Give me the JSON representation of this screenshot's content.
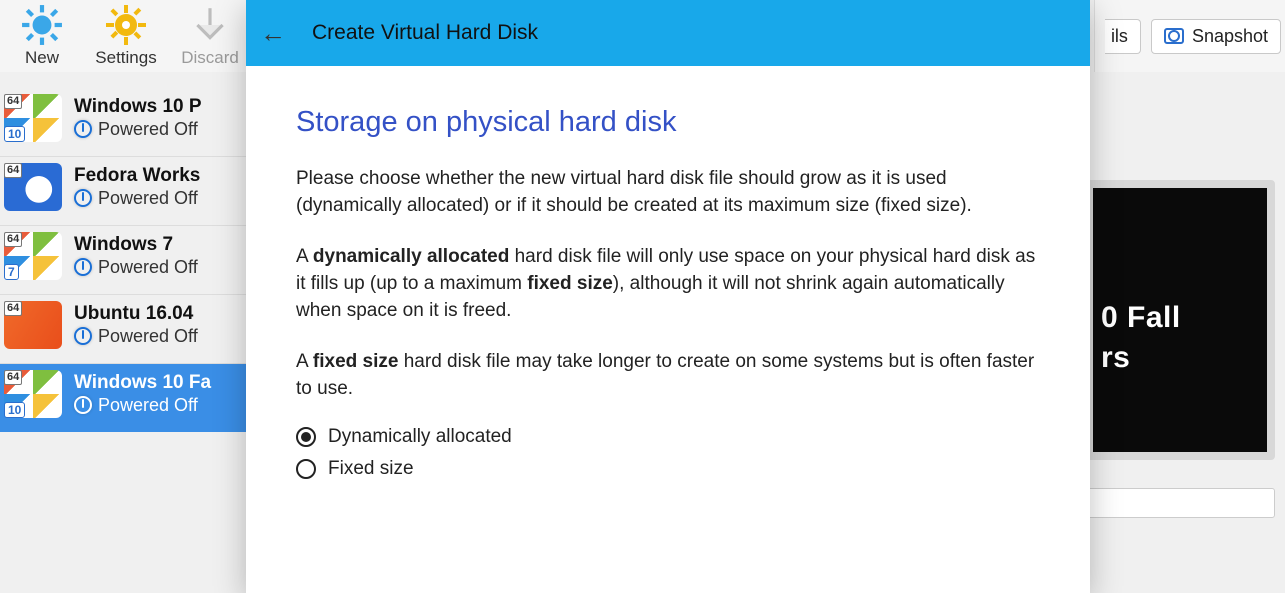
{
  "toolbar": {
    "new": "New",
    "settings": "Settings",
    "discard": "Discard"
  },
  "right": {
    "details_fragment": "ils",
    "snapshots": "Snapshot"
  },
  "preview": {
    "line1": "0 Fall",
    "line2": "rs"
  },
  "state_label": "Powered Off",
  "vms": [
    {
      "name": "Windows 10 P",
      "badge": "10"
    },
    {
      "name": "Fedora Works",
      "badge": ""
    },
    {
      "name": "Windows 7",
      "badge": "7"
    },
    {
      "name": "Ubuntu 16.04",
      "badge": ""
    },
    {
      "name": "Windows 10 Fa",
      "badge": "10"
    }
  ],
  "dialog": {
    "back_glyph": "←",
    "title": "Create Virtual Hard Disk",
    "heading": "Storage on physical hard disk",
    "p1": "Please choose whether the new virtual hard disk file should grow as it is used (dynamically allocated) or if it should be created at its maximum size (fixed size).",
    "p2a": "A ",
    "p2b": "dynamically allocated",
    "p2c": " hard disk file will only use space on your physical hard disk as it fills up (up to a maximum ",
    "p2d": "fixed size",
    "p2e": "), although it will not shrink again automatically when space on it is freed.",
    "p3a": "A ",
    "p3b": "fixed size",
    "p3c": " hard disk file may take longer to create on some systems but is often faster to use.",
    "opt1": "Dynamically allocated",
    "opt2": "Fixed size",
    "selected": "opt1"
  }
}
